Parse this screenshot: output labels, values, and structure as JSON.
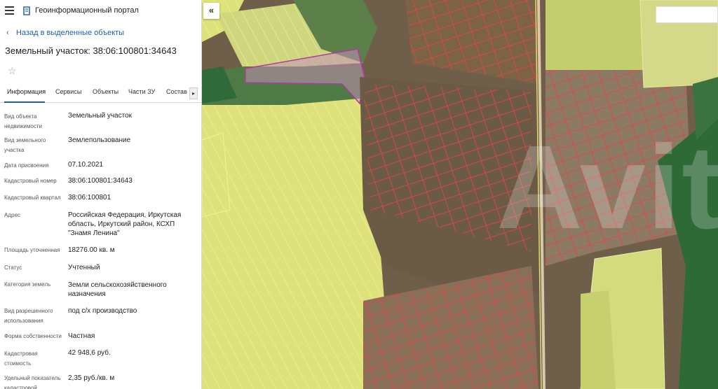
{
  "app": {
    "title": "Геоинформационный портал"
  },
  "nav": {
    "back_label": "Назад в выделенные объекты"
  },
  "object": {
    "title": "Земельный участок: 38:06:100801:34643"
  },
  "tabs": [
    {
      "label": "Информация",
      "active": true
    },
    {
      "label": "Сервисы",
      "active": false
    },
    {
      "label": "Объекты",
      "active": false
    },
    {
      "label": "Части ЗУ",
      "active": false
    },
    {
      "label": "Состав",
      "active": false
    }
  ],
  "icons": {
    "menu": "menu-icon",
    "logo": "portal-logo-icon",
    "back": "chevron-left-icon",
    "favorite": "star-icon",
    "tabs_next": "chevron-right-icon",
    "collapse": "double-chevron-left-icon"
  },
  "info": [
    {
      "label": "Вид объекта недвижимости",
      "value": "Земельный участок"
    },
    {
      "label": "Вид земельного участка",
      "value": "Землепользование"
    },
    {
      "label": "Дата присвоения",
      "value": "07.10.2021"
    },
    {
      "label": "Кадастровый номер",
      "value": "38:06:100801:34643"
    },
    {
      "label": "Кадастровый квартал",
      "value": "38:06:100801"
    },
    {
      "label": "Адрес",
      "value": "Российская Федерация, Иркутская область, Иркутский район, КСХП \"Знамя Ленина\""
    },
    {
      "label": "Площадь уточненная",
      "value": "18276.00 кв. м"
    },
    {
      "label": "Статус",
      "value": "Учтенный"
    },
    {
      "label": "Категория земель",
      "value": "Земли сельскохозяйственного назначения"
    },
    {
      "label": "Вид разрешенного использования",
      "value": "под с/х производство"
    },
    {
      "label": "Форма собственности",
      "value": "Частная"
    },
    {
      "label": "Кадастровая стоимость",
      "value": "42 948,6 руб."
    },
    {
      "label": "Удельный показатель кадастровой",
      "value": "2,35 руб./кв. м"
    }
  ],
  "map": {
    "watermark": "Avito"
  },
  "colors": {
    "accent": "#1f5fa8",
    "parcel_yellow": "#e6e98a",
    "parcel_border_red": "#e04646",
    "selected_parcel": "#c58fb8",
    "forest": "#2f6a3a"
  }
}
